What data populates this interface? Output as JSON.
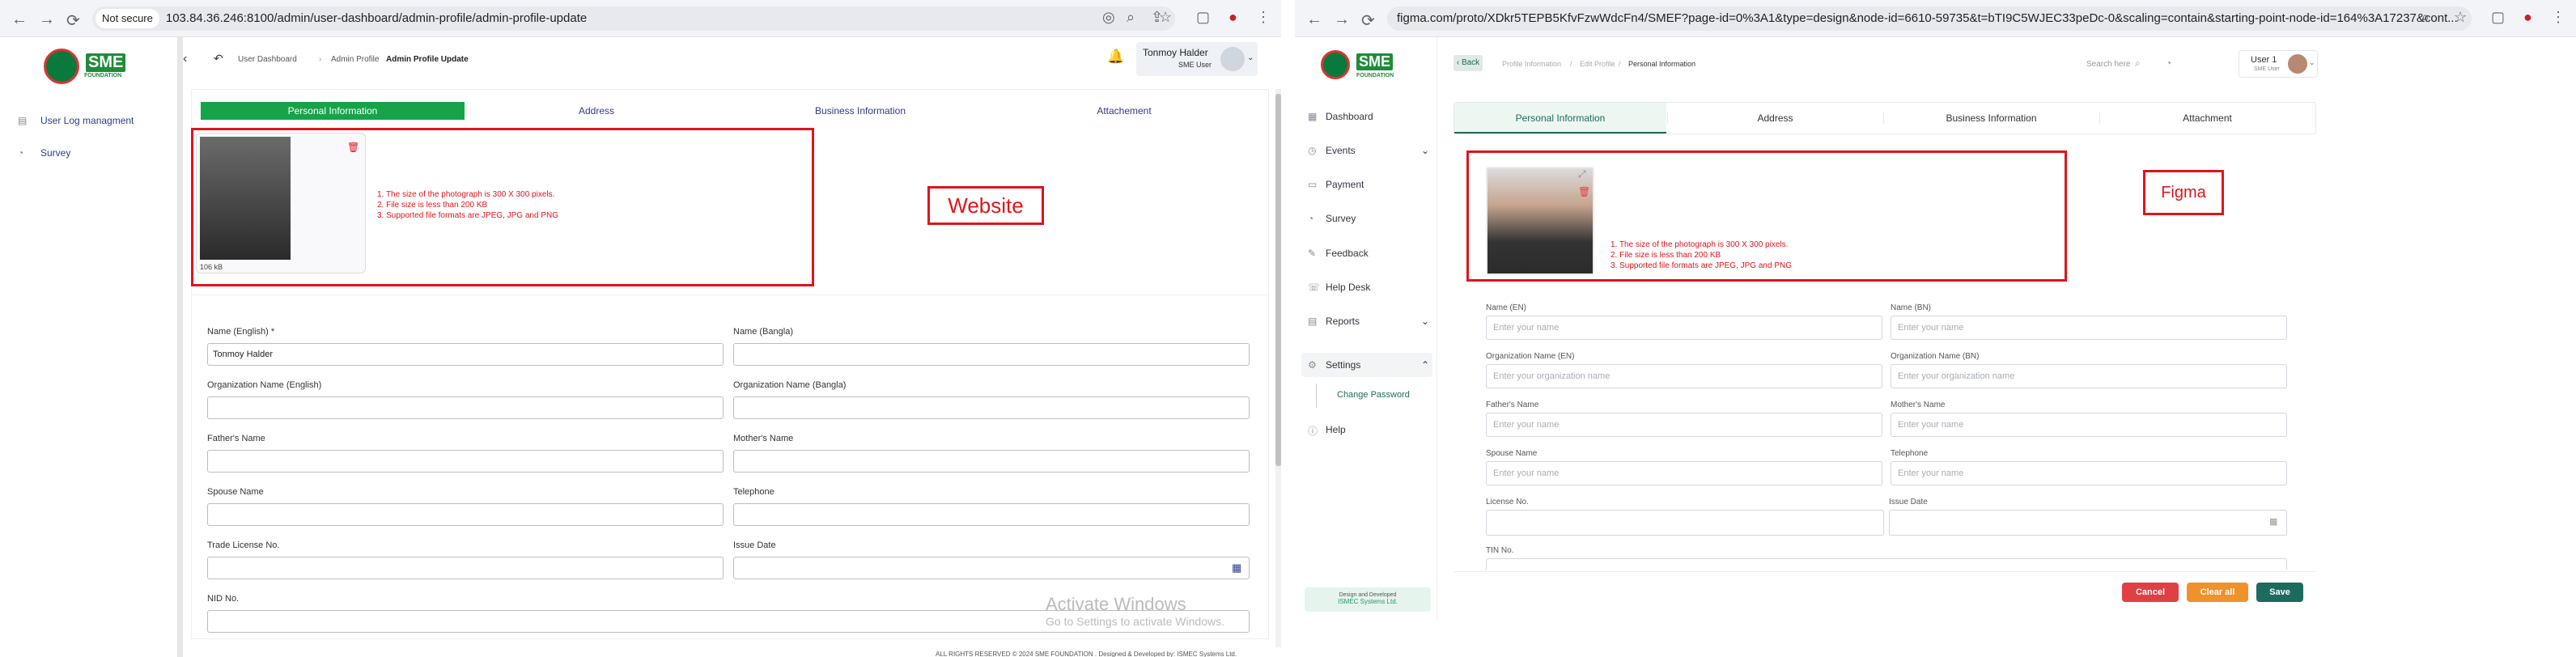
{
  "left": {
    "browser": {
      "url_prefix": "Not secure",
      "url": "103.84.36.246:8100/admin/user-dashboard/admin-profile/admin-profile-update"
    },
    "sidebar": {
      "items": [
        {
          "label": "User Log managment"
        },
        {
          "label": "Survey"
        }
      ]
    },
    "header": {
      "crumbs": [
        "User Dashboard",
        "Admin Profile"
      ],
      "current": "Admin Profile Update",
      "user_name": "Tonmoy Halder",
      "user_role": "SME User"
    },
    "tabs": [
      "Personal Information",
      "Address",
      "Business Information",
      "Attachement"
    ],
    "photo": {
      "size": "106 kB",
      "rules": [
        "1. The size of the photograph is 300 X 300 pixels.",
        "2. File size is less than 200 KB",
        "3. Supported file formats are JPEG, JPG and PNG"
      ]
    },
    "annotation": "Website",
    "fields": [
      {
        "label": "Name (English) *",
        "value": "Tonmoy Halder"
      },
      {
        "label": "Name (Bangla)",
        "value": ""
      },
      {
        "label": "Organization Name (English)",
        "value": ""
      },
      {
        "label": "Organization Name (Bangla)",
        "value": ""
      },
      {
        "label": "Father's Name",
        "value": ""
      },
      {
        "label": "Mother's Name",
        "value": ""
      },
      {
        "label": "Spouse Name",
        "value": ""
      },
      {
        "label": "Telephone",
        "value": ""
      },
      {
        "label": "Trade License No.",
        "value": ""
      },
      {
        "label": "Issue Date",
        "value": ""
      },
      {
        "label": "NID No.",
        "value": ""
      }
    ],
    "activate": {
      "title": "Activate Windows",
      "sub": "Go to Settings to activate Windows."
    },
    "footer": "ALL RIGHTS RESERVED © 2024 SME FOUNDATION . Designed & Developed by: ISMEC Systems Ltd."
  },
  "right": {
    "browser": {
      "url": "figma.com/proto/XDkr5TEPB5KfvFzwWdcFn4/SMEF?page-id=0%3A1&type=design&node-id=6610-59735&t=bTI9C5WJEC33peDc-0&scaling=contain&starting-point-node-id=164%3A17237&cont..."
    },
    "sidebar": {
      "items": [
        {
          "label": "Dashboard"
        },
        {
          "label": "Events"
        },
        {
          "label": "Payment"
        },
        {
          "label": "Survey"
        },
        {
          "label": "Feedback"
        },
        {
          "label": "Help Desk"
        },
        {
          "label": "Reports"
        },
        {
          "label": "Settings"
        },
        {
          "label": "Change Password"
        },
        {
          "label": "Help"
        }
      ],
      "footer_a": "Design and Developed",
      "footer_b": "ISMEC Systems Ltd."
    },
    "header": {
      "back": "Back",
      "crumbs": [
        "Profile Information",
        "Edit Profile"
      ],
      "current": "Personal Information",
      "search": "Search here",
      "user_name": "User 1",
      "user_role": "SME User"
    },
    "tabs": [
      "Personal Information",
      "Address",
      "Business Information",
      "Attachment"
    ],
    "photo": {
      "rules": [
        "1. The size of the photograph is 300 X 300 pixels.",
        "2. File size is less than 200 KB",
        "3. Supported file formats are JPEG, JPG and PNG"
      ]
    },
    "annotation": "Figma",
    "fields": [
      {
        "label": "Name (EN)",
        "placeholder": "Enter your name"
      },
      {
        "label": "Name (BN)",
        "placeholder": "Enter your name"
      },
      {
        "label": "Organization Name (EN)",
        "placeholder": "Enter your organization name"
      },
      {
        "label": "Organization Name (BN)",
        "placeholder": "Enter your organization name"
      },
      {
        "label": "Father's Name",
        "placeholder": "Enter your name"
      },
      {
        "label": "Mother's Name",
        "placeholder": "Enter your name"
      },
      {
        "label": "Spouse Name",
        "placeholder": "Enter your name"
      },
      {
        "label": "Telephone",
        "placeholder": "Enter your name"
      },
      {
        "label": "License No.",
        "placeholder": ""
      },
      {
        "label": "Issue Date",
        "placeholder": ""
      },
      {
        "label": "TIN No.",
        "placeholder": ""
      }
    ],
    "buttons": {
      "cancel": "Cancel",
      "clear": "Clear all",
      "save": "Save"
    }
  },
  "colors": {
    "green": "#17a34a",
    "red": "#e0141b",
    "orange": "#f0922b",
    "teal": "#1d6b5e",
    "cancel": "#e04044"
  }
}
